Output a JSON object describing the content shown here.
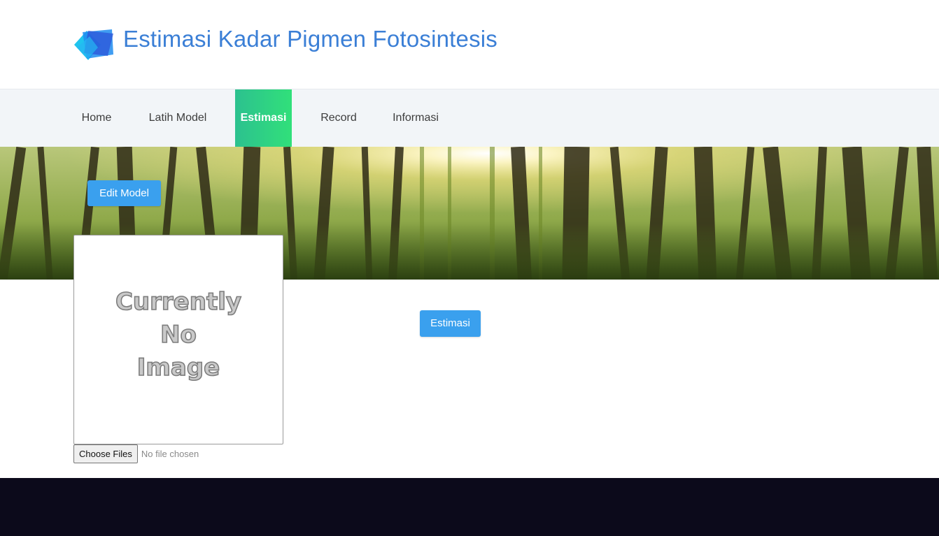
{
  "header": {
    "title": "Estimasi Kadar Pigmen Fotosintesis",
    "logo_icon": "layered-squares-logo-icon",
    "title_color": "#3b7fd6"
  },
  "nav": {
    "items": [
      {
        "label": "Home",
        "active": false
      },
      {
        "label": "Latih Model",
        "active": false
      },
      {
        "label": "Estimasi",
        "active": true
      },
      {
        "label": "Record",
        "active": false
      },
      {
        "label": "Informasi",
        "active": false
      }
    ],
    "active_color": "#2ecf86"
  },
  "hero": {
    "edit_model_label": "Edit Model"
  },
  "image_preview": {
    "placeholder_text": "Currently\nNo\nImage"
  },
  "file_input": {
    "button_label": "Choose Files",
    "status": "No file chosen"
  },
  "actions": {
    "estimasi_label": "Estimasi",
    "button_color": "#3aa0ee"
  },
  "footer": {
    "background": "#0c0a1b"
  }
}
